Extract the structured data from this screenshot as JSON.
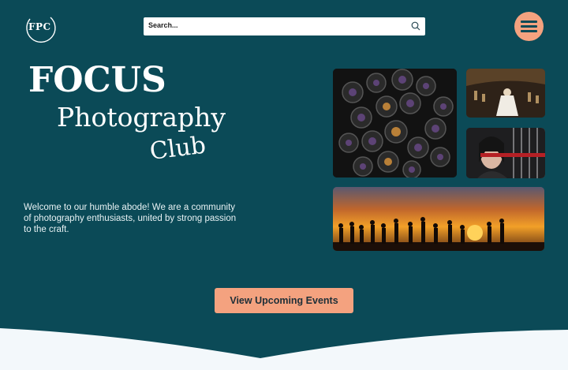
{
  "header": {
    "logo_text": "FPC",
    "search_placeholder": "Search...",
    "menu_icon": "hamburger-menu-icon"
  },
  "hero": {
    "title_line1": "FOCUS",
    "title_line2": "Photography",
    "title_line3": "Club",
    "intro": "Welcome to our humble abode! We are a community of photography enthusiasts, united by strong passion to the craft."
  },
  "cta": {
    "label": "View Upcoming Events"
  },
  "colors": {
    "background": "#0b4a57",
    "accent": "#f4a27f",
    "footer_wave": "#f3f8fb"
  }
}
